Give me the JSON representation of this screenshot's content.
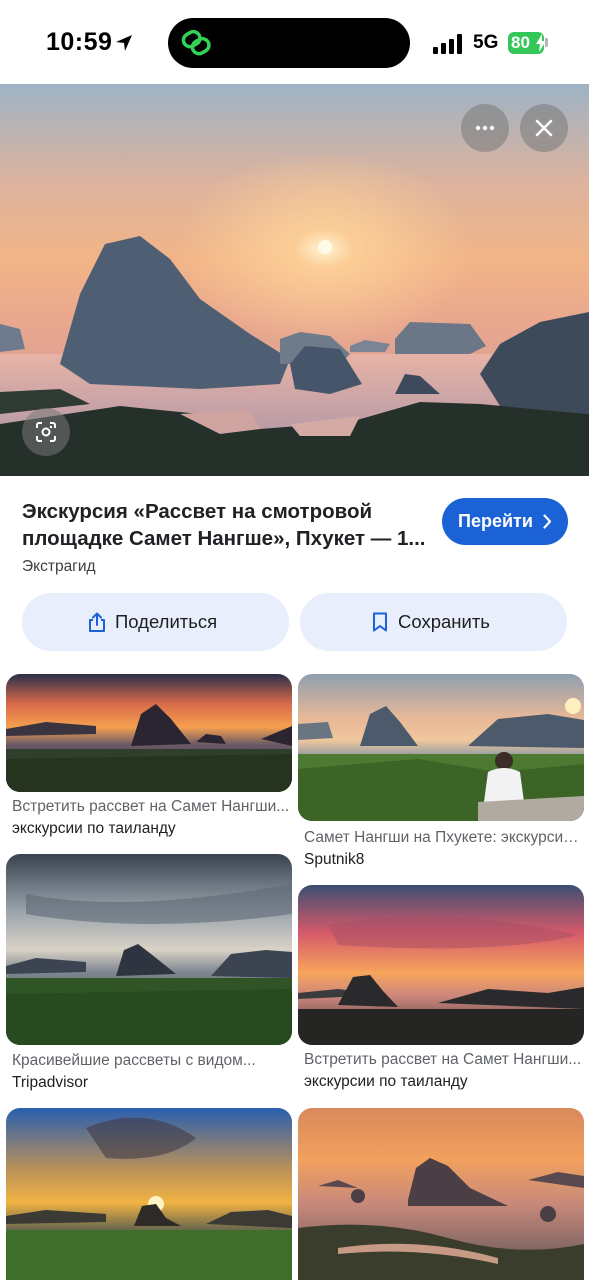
{
  "status_bar": {
    "time": "10:59",
    "network": "5G",
    "battery": "80"
  },
  "result": {
    "title": "Экскурсия «Рассвет на смотровой площадке Самет Нангше», Пхукет — 1...",
    "source": "Экстрагид",
    "go_label": "Перейти"
  },
  "actions": {
    "share_label": "Поделиться",
    "save_label": "Сохранить"
  },
  "related": [
    {
      "caption": "Встретить рассвет на Самет Нангши...",
      "site": "экскурсии по таиланду"
    },
    {
      "caption": "Самет Нангши на Пхукете: экскурсия...",
      "site": "Sputnik8"
    },
    {
      "caption": "Красивейшие рассветы с видом...",
      "site": "Tripadvisor"
    },
    {
      "caption": "Встретить рассвет на Самет Нангши...",
      "site": "экскурсии по таиланду"
    }
  ],
  "icons": {
    "location": "location-arrow-icon",
    "app": "link-icon",
    "more": "more-dots-icon",
    "close": "close-icon",
    "lens": "lens-camera-icon",
    "share": "share-icon",
    "save": "bookmark-icon",
    "chevron": "chevron-right-icon"
  },
  "colors": {
    "accent": "#1a62d6",
    "action_bg": "#e8eefb",
    "battery": "#34c759"
  }
}
